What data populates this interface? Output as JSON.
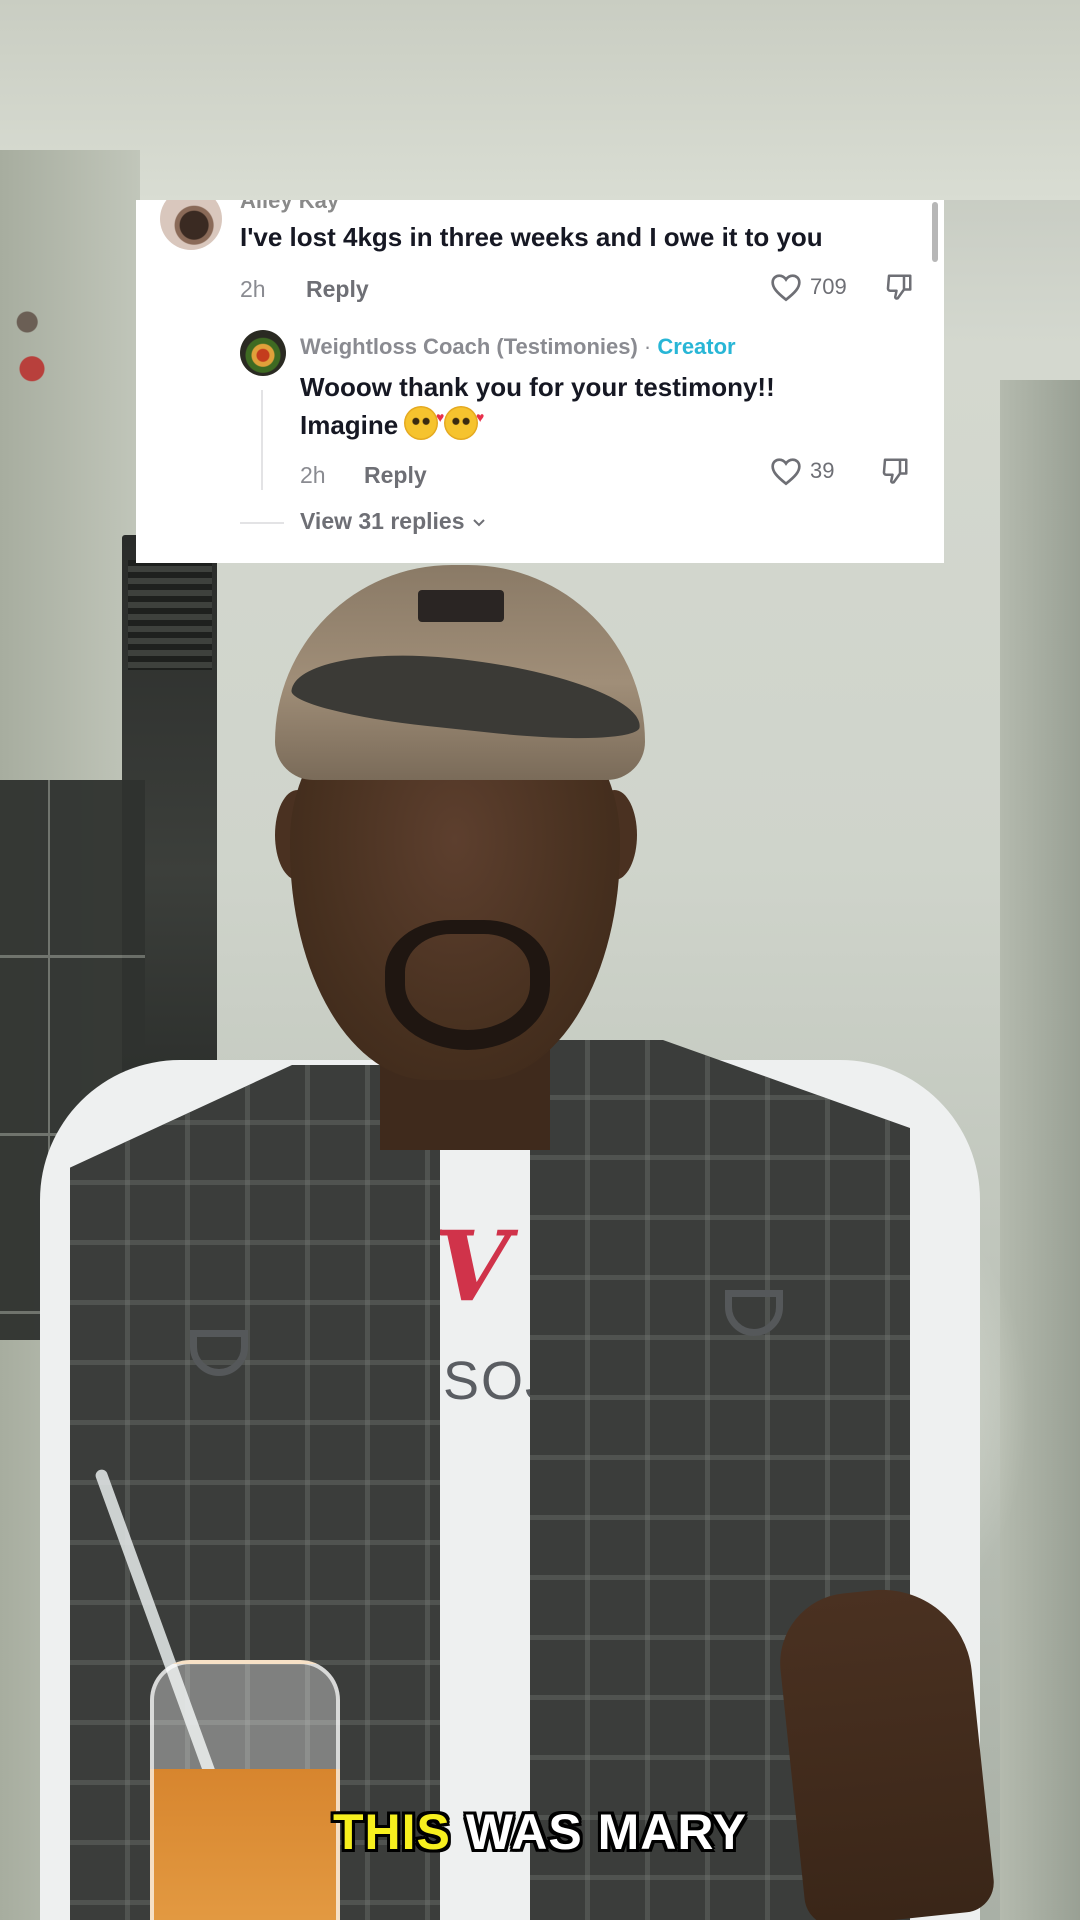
{
  "comment": {
    "author": "Ailey Kay",
    "text": "I've lost 4kgs in three weeks and I owe it to you",
    "time": "2h",
    "reply_label": "Reply",
    "likes": "709"
  },
  "creator_reply": {
    "author": "Weightloss Coach (Testimonies)",
    "separator": "·",
    "badge": "Creator",
    "text_line1": "Wooow thank you for your testimony!!",
    "text_line2": "Imagine",
    "time": "2h",
    "reply_label": "Reply",
    "likes": "39"
  },
  "view_replies": "View 31 replies",
  "caption": {
    "highlight_word": "THIS",
    "rest": "WAS MARY"
  },
  "colors": {
    "creator_badge": "#28b6d6",
    "caption_highlight": "#f6ef1e"
  },
  "icons": [
    "heart-outline-icon",
    "thumbs-down-icon",
    "chevron-down-icon",
    "smiling-face-with-hearts-emoji"
  ]
}
